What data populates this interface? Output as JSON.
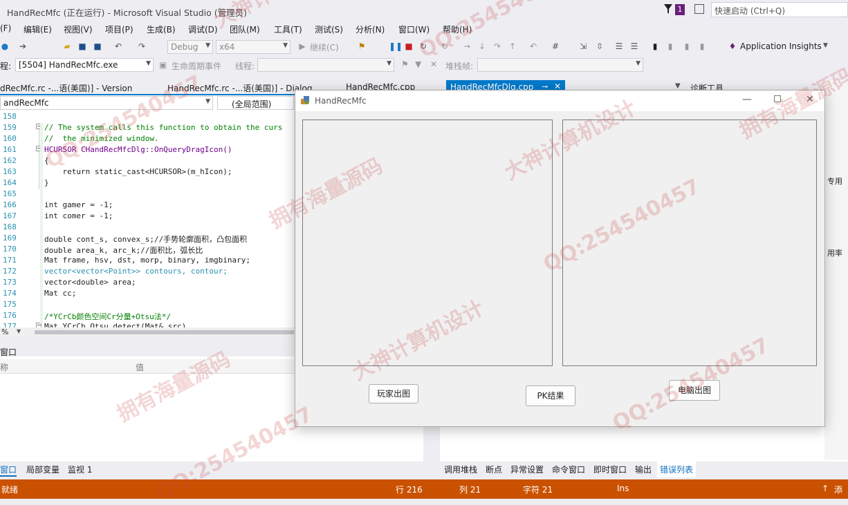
{
  "window": {
    "title": "HandRecMfc (正在运行) - Microsoft Visual Studio (管理员)",
    "notif_count": "1",
    "quick_launch": "快速启动 (Ctrl+Q)"
  },
  "menu": [
    "(F)",
    "编辑(E)",
    "视图(V)",
    "项目(P)",
    "生成(B)",
    "调试(D)",
    "团队(M)",
    "工具(T)",
    "测试(S)",
    "分析(N)",
    "窗口(W)",
    "帮助(H)"
  ],
  "toolbar": {
    "config": "Debug",
    "platform": "x64",
    "continue": "继续(C)",
    "insights": "Application Insights"
  },
  "procbar": {
    "label": "程:",
    "process": "[5504] HandRecMfc.exe",
    "lifecycle": "生命周期事件",
    "thread": "线程:",
    "stackframe": "堆栈帧:"
  },
  "tabs": [
    "dRecMfc.rc -...语(美国)] - Version",
    "HandRecMfc.rc -...语(美国)] - Dialog",
    "HandRecMfc.cpp"
  ],
  "active_tab": "HandRecMfcDlg.cpp",
  "diag_tools": "诊断工具",
  "nav": {
    "class": "andRecMfc",
    "scope": "(全局范围)"
  },
  "code": {
    "lines": [
      {
        "n": "158",
        "t": ""
      },
      {
        "n": "159",
        "t": "// The system calls this function to obtain the curs"
      },
      {
        "n": "160",
        "t": "//  the minimized window."
      },
      {
        "n": "161",
        "t": "HCURSOR CHandRecMfcDlg::OnQueryDragIcon()"
      },
      {
        "n": "162",
        "t": "{"
      },
      {
        "n": "163",
        "t": "    return static_cast<HCURSOR>(m_hIcon);"
      },
      {
        "n": "164",
        "t": "}"
      },
      {
        "n": "165",
        "t": ""
      },
      {
        "n": "166",
        "t": "int gamer = -1;"
      },
      {
        "n": "167",
        "t": "int comer = -1;"
      },
      {
        "n": "168",
        "t": ""
      },
      {
        "n": "169",
        "t": "double cont_s, convex_s;//手势轮廓面积，凸包面积"
      },
      {
        "n": "170",
        "t": "double area_k, arc_k;//面积比，弧长比"
      },
      {
        "n": "171",
        "t": "Mat frame, hsv, dst, morp, binary, imgbinary;"
      },
      {
        "n": "172",
        "t": "vector<vector<Point>> contours, contour;"
      },
      {
        "n": "173",
        "t": "vector<double> area;"
      },
      {
        "n": "174",
        "t": "Mat cc;"
      },
      {
        "n": "175",
        "t": ""
      },
      {
        "n": "176",
        "t": "/*YCrCb颜色空间Cr分量+Otsu法*/"
      },
      {
        "n": "177",
        "t": "Mat YCrCb_Otsu_detect(Mat& src)"
      }
    ]
  },
  "zoom": "%",
  "lower_left": {
    "title": "窗口",
    "col_name": "称",
    "col_value": "值"
  },
  "bottom_tabs_left": [
    "窗口",
    "局部变量",
    "监视 1"
  ],
  "bottom_tabs_right": [
    "调用堆栈",
    "断点",
    "异常设置",
    "命令窗口",
    "即时窗口",
    "输出",
    "错误列表"
  ],
  "right_panel": {
    "item1": "专用",
    "item2": "用率"
  },
  "status": {
    "ready": "就绪",
    "row": "行 216",
    "col": "列 21",
    "char": "字符 21",
    "ins": "Ins",
    "add": "添"
  },
  "dialog": {
    "title": "HandRecMfc",
    "buttons": {
      "player": "玩家出图",
      "pk": "PK结果",
      "computer": "电脑出图"
    }
  },
  "watermark": {
    "a": "QQ:254540457",
    "b": "拥有海量源码",
    "c": "大神计算机设计"
  },
  "colors": {
    "accent": "#007acc",
    "status": "#ca5100"
  }
}
